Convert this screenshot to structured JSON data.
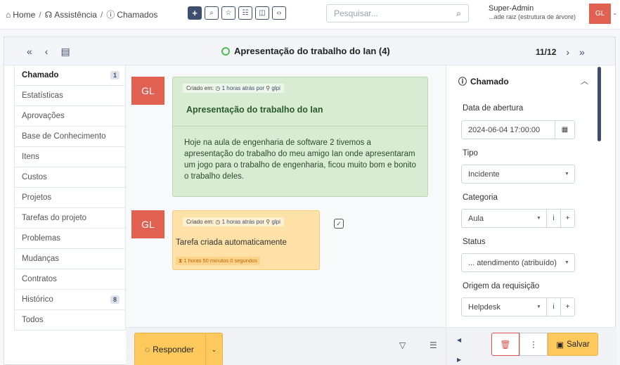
{
  "breadcrumb": {
    "home": "Home",
    "section": "Assistência",
    "page": "Chamados",
    "separator": "/"
  },
  "toolbar": {
    "buttons": [
      "add",
      "search",
      "star",
      "list",
      "columns",
      "code"
    ]
  },
  "search": {
    "placeholder": "Pesquisar..."
  },
  "user": {
    "name": "Super-Admin",
    "entity": "...ade raiz (estrutura de árvore)",
    "initials": "GL"
  },
  "ticket": {
    "title": "Apresentação do trabalho do Ian (4)",
    "position": "11/12"
  },
  "tabs": [
    {
      "label": "Chamado",
      "badge": "1"
    },
    {
      "label": "Estatísticas"
    },
    {
      "label": "Aprovações"
    },
    {
      "label": "Base de Conhecimento"
    },
    {
      "label": "Itens"
    },
    {
      "label": "Custos"
    },
    {
      "label": "Projetos"
    },
    {
      "label": "Tarefas do projeto"
    },
    {
      "label": "Problemas"
    },
    {
      "label": "Mudanças"
    },
    {
      "label": "Contratos"
    },
    {
      "label": "Histórico",
      "badge": "8"
    },
    {
      "label": "Todos"
    }
  ],
  "timeline": {
    "followup": {
      "avatar": "GL",
      "meta_prefix": "Criado em:",
      "meta_time": "1 horas atrás por",
      "meta_user": "glpi",
      "title": "Apresentação do trabalho do Ian",
      "body": "Hoje na aula de engenharia de software 2 tivemos a apresentação do trabalho do meu amigo Ian onde apresentaram um jogo para o trabalho de engenharia, ficou muito bom e bonito o trabalho deles."
    },
    "task": {
      "avatar": "GL",
      "meta_prefix": "Criado em:",
      "meta_time": "1 horas atrás por",
      "meta_user": "glpi",
      "body": "Tarefa criada automaticamente",
      "duration": "1 horas 50 minutos 0 segundos"
    }
  },
  "actions": {
    "reply": "Responder",
    "save": "Salvar"
  },
  "panel": {
    "title": "Chamado",
    "opening_date_label": "Data de abertura",
    "opening_date": "2024-06-04 17:00:00",
    "type_label": "Tipo",
    "type": "Incidente",
    "category_label": "Categoria",
    "category": "Aula",
    "status_label": "Status",
    "status": "... atendimento (atribuído)",
    "origin_label": "Origem da requisição",
    "origin": "Helpdesk"
  },
  "colors": {
    "accent": "#3d4e6e",
    "avatar": "#e06152",
    "followup_bg": "#d8ecd3",
    "task_bg": "#fde1a6",
    "action_yellow": "#fec95c",
    "status_new": "#49bf4d"
  }
}
